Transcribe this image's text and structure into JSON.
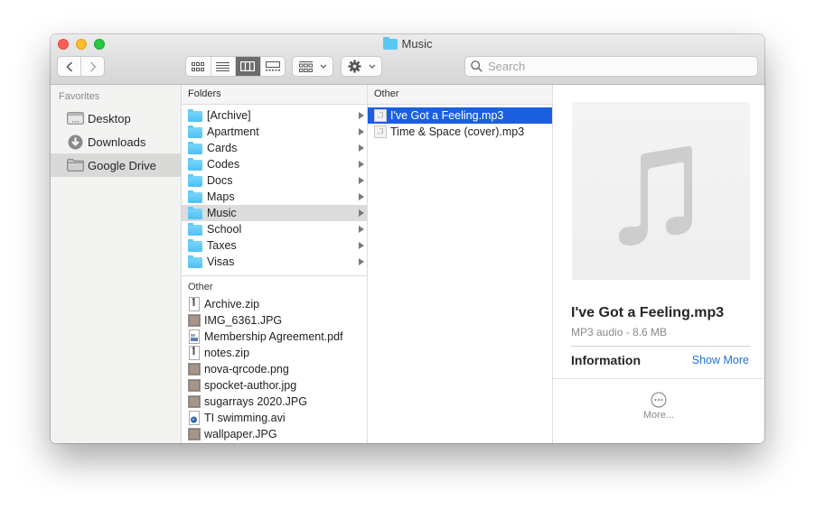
{
  "window": {
    "title": "Music",
    "title_icon": "folder-icon"
  },
  "toolbar": {
    "back_icon": "chevron-left-icon",
    "forward_icon": "chevron-right-icon",
    "view_modes": [
      {
        "name": "icon-view",
        "icon": "grid-icon",
        "active": false
      },
      {
        "name": "list-view",
        "icon": "list-icon",
        "active": false
      },
      {
        "name": "column-view",
        "icon": "columns-icon",
        "active": true
      },
      {
        "name": "gallery-view",
        "icon": "gallery-icon",
        "active": false
      }
    ],
    "group_icon": "group-by-icon",
    "action_icon": "gear-icon",
    "search_placeholder": "Search",
    "search_value": ""
  },
  "sidebar": {
    "heading": "Favorites",
    "items": [
      {
        "label": "Desktop",
        "icon": "desktop-icon",
        "selected": false
      },
      {
        "label": "Downloads",
        "icon": "downloads-icon",
        "selected": false
      },
      {
        "label": "Google Drive",
        "icon": "folder-icon",
        "selected": true
      }
    ]
  },
  "column1": {
    "header": "Folders",
    "folders": [
      {
        "label": "[Archive]"
      },
      {
        "label": "Apartment"
      },
      {
        "label": "Cards"
      },
      {
        "label": "Codes"
      },
      {
        "label": "Docs"
      },
      {
        "label": "Maps"
      },
      {
        "label": "Music",
        "highlighted": true
      },
      {
        "label": "School"
      },
      {
        "label": "Taxes"
      },
      {
        "label": "Visas"
      }
    ],
    "other_header": "Other",
    "files": [
      {
        "label": "Archive.zip",
        "icon": "zip-icon"
      },
      {
        "label": "IMG_6361.JPG",
        "icon": "image-icon"
      },
      {
        "label": "Membership Agreement.pdf",
        "icon": "pdf-icon"
      },
      {
        "label": "notes.zip",
        "icon": "zip-icon"
      },
      {
        "label": "nova-qrcode.png",
        "icon": "image-icon"
      },
      {
        "label": "spocket-author.jpg",
        "icon": "image-icon"
      },
      {
        "label": "sugarrays 2020.JPG",
        "icon": "image-icon"
      },
      {
        "label": "TI swimming.avi",
        "icon": "video-icon"
      },
      {
        "label": "wallpaper.JPG",
        "icon": "image-icon"
      }
    ]
  },
  "column2": {
    "header": "Other",
    "files": [
      {
        "label": "I've Got a Feeling.mp3",
        "icon": "audio-file-icon",
        "selected": true
      },
      {
        "label": "Time & Space (cover).mp3",
        "icon": "audio-file-icon",
        "selected": false
      }
    ]
  },
  "preview": {
    "artwork_icon": "music-note-icon",
    "filename": "I've Got a Feeling.mp3",
    "meta": "MP3 audio - 8.6 MB",
    "info_label": "Information",
    "show_more": "Show More",
    "more_label": "More...",
    "more_icon": "ellipsis-circle-icon"
  },
  "colors": {
    "selection": "#1a5fe0",
    "folder": "#5ac8f5",
    "link": "#1f6fd6"
  }
}
